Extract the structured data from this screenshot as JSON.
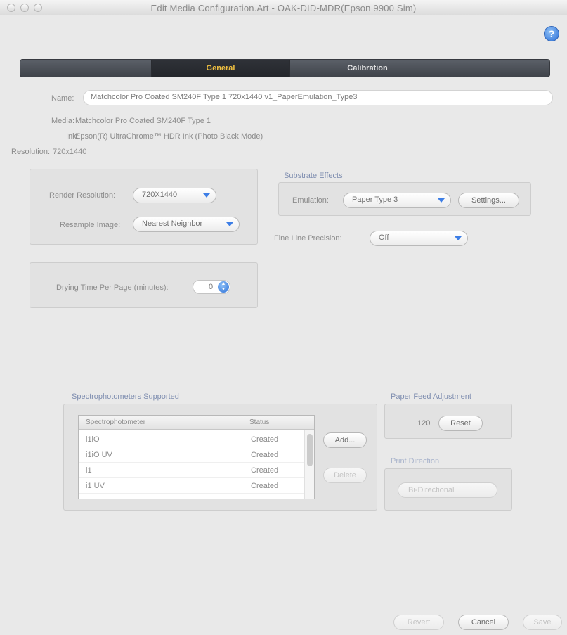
{
  "window": {
    "title": "Edit Media Configuration.Art - OAK-DID-MDR(Epson 9900 Sim)"
  },
  "tabs": [
    {
      "label": "General",
      "active": true
    },
    {
      "label": "Calibration",
      "active": false
    }
  ],
  "info": {
    "name_label": "Name:",
    "name_value": "Matchcolor Pro Coated SM240F Type 1 720x1440 v1_PaperEmulation_Type3",
    "media_label": "Media:",
    "media_value": "Matchcolor Pro Coated SM240F Type 1",
    "ink_label": "Ink:",
    "ink_value": "Epson(R) UltraChrome™ HDR Ink (Photo Black Mode)",
    "resolution_label": "Resolution:",
    "resolution_value": "720x1440"
  },
  "render": {
    "resolution_label": "Render Resolution:",
    "resolution_value": "720X1440",
    "resample_label": "Resample Image:",
    "resample_value": "Nearest Neighbor"
  },
  "dry_time": {
    "label": "Drying Time Per Page (minutes):",
    "value": "0"
  },
  "substrate": {
    "title": "Substrate Effects",
    "emulation_label": "Emulation:",
    "emulation_value": "Paper Type 3",
    "settings_button": "Settings..."
  },
  "fine_line": {
    "label": "Fine Line Precision:",
    "value": "Off"
  },
  "spectro": {
    "title": "Spectrophotometers Supported",
    "col_spectro": "Spectrophotometer",
    "col_status": "Status",
    "rows": [
      {
        "name": "i1iO",
        "status": "Created"
      },
      {
        "name": "i1iO UV",
        "status": "Created"
      },
      {
        "name": "i1",
        "status": "Created"
      },
      {
        "name": "i1 UV",
        "status": "Created"
      }
    ],
    "add_button": "Add...",
    "delete_button": "Delete"
  },
  "paper_feed": {
    "title": "Paper Feed Adjustment",
    "value": "120",
    "reset_button": "Reset"
  },
  "print_direction": {
    "title": "Print Direction",
    "value": "Bi-Directional"
  },
  "footer": {
    "revert_button": "Revert",
    "cancel_button": "Cancel",
    "save_button": "Save"
  }
}
